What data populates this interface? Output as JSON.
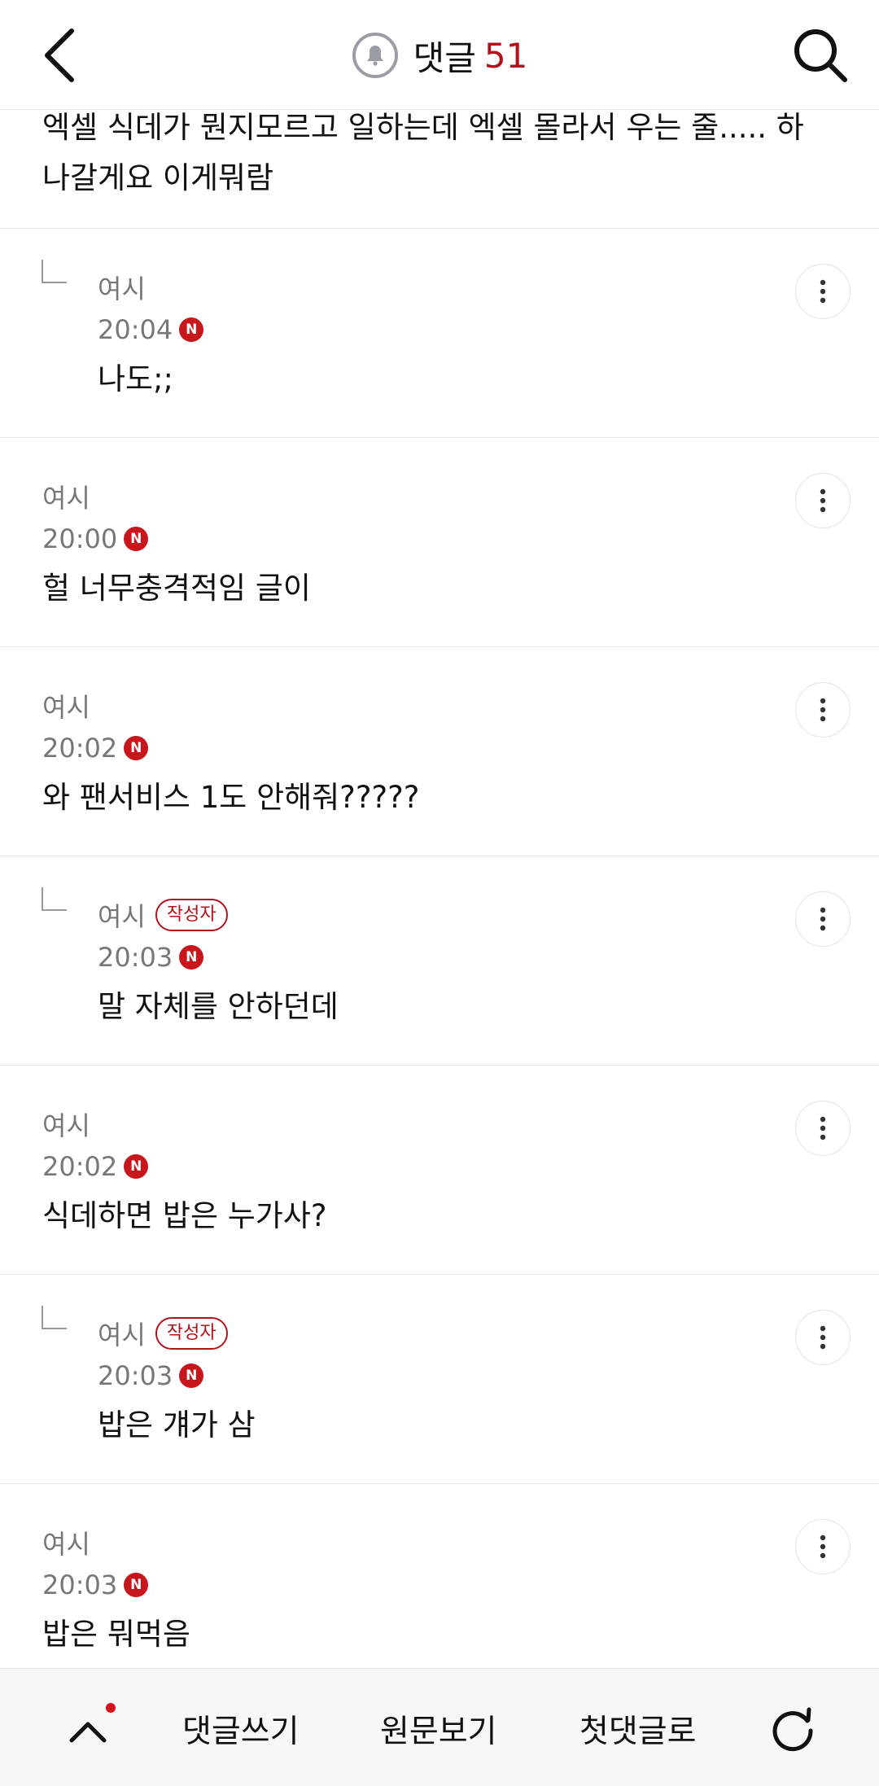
{
  "header": {
    "title": "댓글",
    "count": "51",
    "icons": {
      "back": "chevron-left-icon",
      "bell": "bell-icon",
      "search": "search-icon"
    }
  },
  "intro": {
    "text": "엑셀 식데가 뭔지모르고 일하는데 엑셀 몰라서 우는 줄..... 하 나갈게요 이게뭐람"
  },
  "colors": {
    "accent": "#b3121c",
    "new_badge": "#c8161d",
    "meta": "#777777"
  },
  "comments": [
    {
      "reply": true,
      "author": "여시",
      "badge": "",
      "time": "20:04",
      "new": "N",
      "text": "나도;;"
    },
    {
      "reply": false,
      "author": "여시",
      "badge": "",
      "time": "20:00",
      "new": "N",
      "text": "헐 너무충격적임 글이"
    },
    {
      "reply": false,
      "author": "여시",
      "badge": "",
      "time": "20:02",
      "new": "N",
      "text": "와 팬서비스 1도 안해줘?????"
    },
    {
      "reply": true,
      "author": "여시",
      "badge": "작성자",
      "time": "20:03",
      "new": "N",
      "text": "말 자체를 안하던데"
    },
    {
      "reply": false,
      "author": "여시",
      "badge": "",
      "time": "20:02",
      "new": "N",
      "text": "식데하면 밥은 누가사?"
    },
    {
      "reply": true,
      "author": "여시",
      "badge": "작성자",
      "time": "20:03",
      "new": "N",
      "text": "밥은 걔가 삼"
    },
    {
      "reply": false,
      "author": "여시",
      "badge": "",
      "time": "20:03",
      "new": "N",
      "text": "밥은 뭐먹음"
    }
  ],
  "bottom_bar": {
    "write": "댓글쓰기",
    "original": "원문보기",
    "first": "첫댓글로",
    "icons": {
      "up": "chevron-up-icon",
      "refresh": "refresh-icon"
    }
  }
}
